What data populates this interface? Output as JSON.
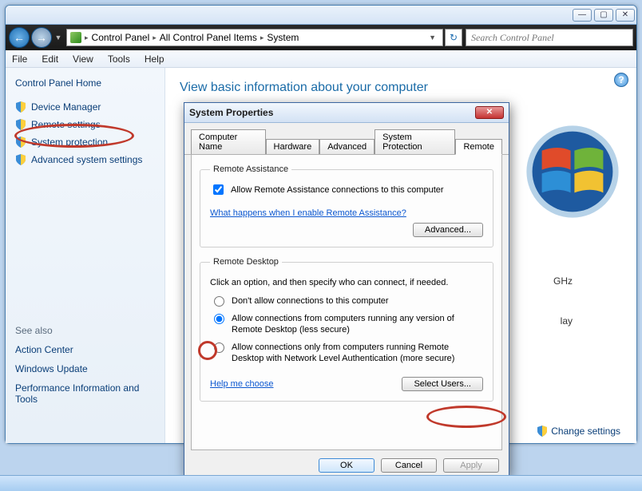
{
  "title_buttons": {
    "min": "—",
    "max": "▢",
    "close": "✕"
  },
  "breadcrumbs": [
    "Control Panel",
    "All Control Panel Items",
    "System"
  ],
  "search_placeholder": "Search Control Panel",
  "menus": [
    "File",
    "Edit",
    "View",
    "Tools",
    "Help"
  ],
  "sidebar": {
    "home": "Control Panel Home",
    "links": [
      {
        "label": "Device Manager",
        "shield": true
      },
      {
        "label": "Remote settings",
        "shield": true
      },
      {
        "label": "System protection",
        "shield": true
      },
      {
        "label": "Advanced system settings",
        "shield": true
      }
    ],
    "see_also_header": "See also",
    "see_also": [
      "Action Center",
      "Windows Update",
      "Performance Information and Tools"
    ]
  },
  "content": {
    "heading": "View basic information about your computer",
    "spec_ghz": "GHz",
    "spec_play": "lay",
    "change_settings": "Change settings"
  },
  "dialog": {
    "title": "System Properties",
    "tabs": [
      "Computer Name",
      "Hardware",
      "Advanced",
      "System Protection",
      "Remote"
    ],
    "active_tab": 4,
    "ra": {
      "legend": "Remote Assistance",
      "checkbox": "Allow Remote Assistance connections to this computer",
      "checked": true,
      "help_link": "What happens when I enable Remote Assistance?",
      "advanced_btn": "Advanced..."
    },
    "rd": {
      "legend": "Remote Desktop",
      "desc": "Click an option, and then specify who can connect, if needed.",
      "options": [
        "Don't allow connections to this computer",
        "Allow connections from computers running any version of Remote Desktop (less secure)",
        "Allow connections only from computers running Remote Desktop with Network Level Authentication (more secure)"
      ],
      "selected": 1,
      "help_link": "Help me choose",
      "select_users_btn": "Select Users..."
    },
    "buttons": {
      "ok": "OK",
      "cancel": "Cancel",
      "apply": "Apply"
    }
  }
}
